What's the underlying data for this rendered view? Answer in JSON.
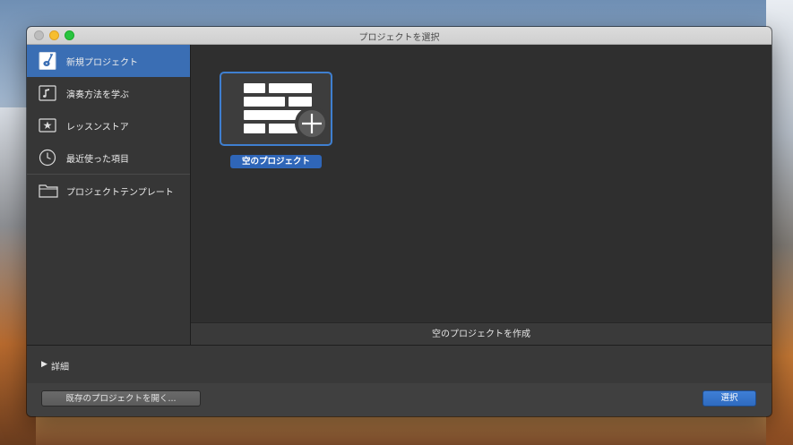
{
  "window": {
    "title": "プロジェクトを選択"
  },
  "sidebar": {
    "items": [
      {
        "label": "新規プロジェクト",
        "icon": "guitar-document-icon",
        "selected": true
      },
      {
        "label": "演奏方法を学ぶ",
        "icon": "music-note-icon",
        "selected": false
      },
      {
        "label": "レッスンストア",
        "icon": "star-box-icon",
        "selected": false
      },
      {
        "label": "最近使った項目",
        "icon": "clock-icon",
        "selected": false
      },
      {
        "label": "プロジェクトテンプレート",
        "icon": "folder-icon",
        "selected": false
      }
    ]
  },
  "content": {
    "tiles": [
      {
        "label": "空のプロジェクト",
        "icon": "empty-project-plus-icon",
        "selected": true
      }
    ],
    "footer_caption": "空のプロジェクトを作成"
  },
  "details": {
    "label": "詳細"
  },
  "buttons": {
    "open_existing": "既存のプロジェクトを開く...",
    "select": "選択"
  },
  "colors": {
    "accent": "#3a6eb4",
    "window_bg": "#2f2f2f"
  }
}
